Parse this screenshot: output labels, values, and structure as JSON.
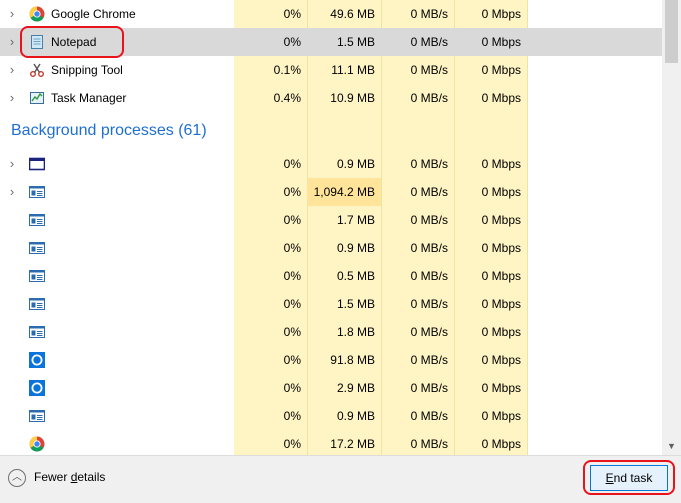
{
  "apps": [
    {
      "name": "Google Chrome",
      "icon": "chrome-icon",
      "cpu": "0%",
      "memory": "49.6 MB",
      "disk": "0 MB/s",
      "network": "0 Mbps",
      "expandable": true
    },
    {
      "name": "Notepad",
      "icon": "notepad-icon",
      "cpu": "0%",
      "memory": "1.5 MB",
      "disk": "0 MB/s",
      "network": "0 Mbps",
      "expandable": true,
      "selected": true
    },
    {
      "name": "Snipping Tool",
      "icon": "snipping-tool-icon",
      "cpu": "0.1%",
      "memory": "11.1 MB",
      "disk": "0 MB/s",
      "network": "0 Mbps",
      "expandable": true
    },
    {
      "name": "Task Manager",
      "icon": "task-manager-icon",
      "cpu": "0.4%",
      "memory": "10.9 MB",
      "disk": "0 MB/s",
      "network": "0 Mbps",
      "expandable": true
    }
  ],
  "background_group": {
    "title": "Background processes (61)"
  },
  "background": [
    {
      "icon": "window-icon",
      "cpu": "0%",
      "memory": "0.9 MB",
      "disk": "0 MB/s",
      "network": "0 Mbps",
      "expandable": true
    },
    {
      "icon": "service-icon",
      "cpu": "0%",
      "memory": "1,094.2 MB",
      "disk": "0 MB/s",
      "network": "0 Mbps",
      "expandable": true,
      "hot": true
    },
    {
      "icon": "service-icon",
      "cpu": "0%",
      "memory": "1.7 MB",
      "disk": "0 MB/s",
      "network": "0 Mbps"
    },
    {
      "icon": "service-icon",
      "cpu": "0%",
      "memory": "0.9 MB",
      "disk": "0 MB/s",
      "network": "0 Mbps"
    },
    {
      "icon": "service-icon",
      "cpu": "0%",
      "memory": "0.5 MB",
      "disk": "0 MB/s",
      "network": "0 Mbps"
    },
    {
      "icon": "service-icon",
      "cpu": "0%",
      "memory": "1.5 MB",
      "disk": "0 MB/s",
      "network": "0 Mbps"
    },
    {
      "icon": "service-icon",
      "cpu": "0%",
      "memory": "1.8 MB",
      "disk": "0 MB/s",
      "network": "0 Mbps"
    },
    {
      "icon": "cortana-icon",
      "cpu": "0%",
      "memory": "91.8 MB",
      "disk": "0 MB/s",
      "network": "0 Mbps"
    },
    {
      "icon": "cortana-icon",
      "cpu": "0%",
      "memory": "2.9 MB",
      "disk": "0 MB/s",
      "network": "0 Mbps"
    },
    {
      "icon": "service-icon",
      "cpu": "0%",
      "memory": "0.9 MB",
      "disk": "0 MB/s",
      "network": "0 Mbps"
    },
    {
      "icon": "chrome-icon",
      "cpu": "0%",
      "memory": "17.2 MB",
      "disk": "0 MB/s",
      "network": "0 Mbps"
    }
  ],
  "footer": {
    "fewer_details_label": "Fewer details",
    "end_task_label": "End task"
  },
  "colors": {
    "accent": "#1f6fd1",
    "highlight_ring": "#e8141c",
    "column_fill": "#fff4c4",
    "column_hot": "#ffe49a"
  }
}
